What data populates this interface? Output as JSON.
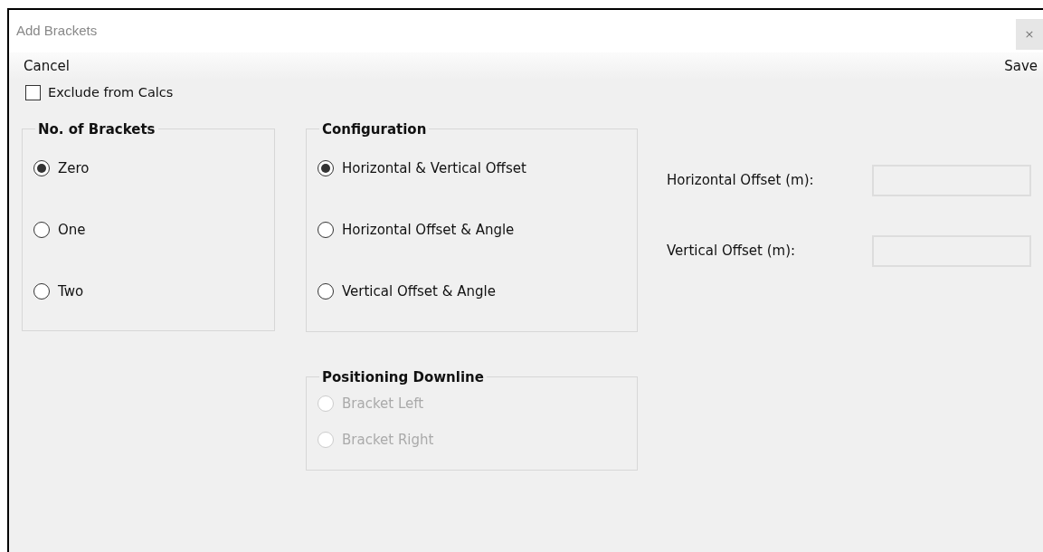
{
  "window": {
    "title": "Add Brackets",
    "close": "×"
  },
  "toolbar": {
    "cancel": "Cancel",
    "save": "Save"
  },
  "exclude": {
    "label": "Exclude from Calcs",
    "checked": false
  },
  "groups": [
    {
      "title": "No. of Brackets",
      "disabled": false,
      "options": [
        {
          "label": "Zero",
          "selected": true
        },
        {
          "label": "One",
          "selected": false
        },
        {
          "label": "Two",
          "selected": false
        }
      ]
    },
    {
      "title": "Configuration",
      "disabled": false,
      "options": [
        {
          "label": "Horizontal & Vertical Offset",
          "selected": true
        },
        {
          "label": "Horizontal Offset & Angle",
          "selected": false
        },
        {
          "label": "Vertical Offset & Angle",
          "selected": false
        }
      ]
    },
    {
      "title": "Positioning Downline",
      "disabled": true,
      "options": [
        {
          "label": "Bracket Left",
          "selected": false
        },
        {
          "label": "Bracket Right",
          "selected": false
        }
      ]
    }
  ],
  "fields": [
    {
      "label": "Horizontal Offset (m):"
    },
    {
      "label": "Vertical Offset (m):"
    }
  ]
}
